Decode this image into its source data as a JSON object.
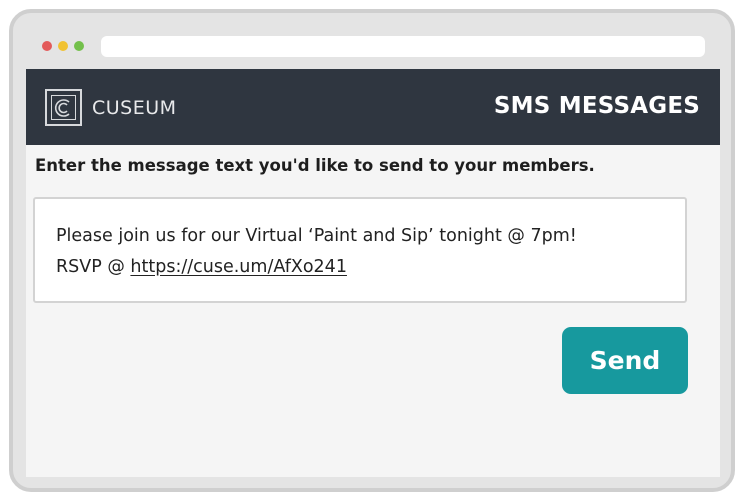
{
  "browser": {
    "traffic_lights": [
      "close",
      "minimize",
      "maximize"
    ],
    "colors": {
      "close": "#e35a5a",
      "minimize": "#f1c232",
      "maximize": "#73c04b"
    }
  },
  "header": {
    "logo_text": "CUSEUM",
    "logo_icon": "cuseum-logo-icon",
    "title": "SMS MESSAGES",
    "background": "#2f3640"
  },
  "form": {
    "prompt": "Enter the message text you'd like to send to your members.",
    "message_line1": "Please join us for our Virtual ‘Paint and Sip’ tonight @ 7pm!",
    "message_prefix": "RSVP @ ",
    "message_link": "https://cuse.um/AfXo241",
    "send_label": "Send",
    "accent": "#17999e"
  }
}
